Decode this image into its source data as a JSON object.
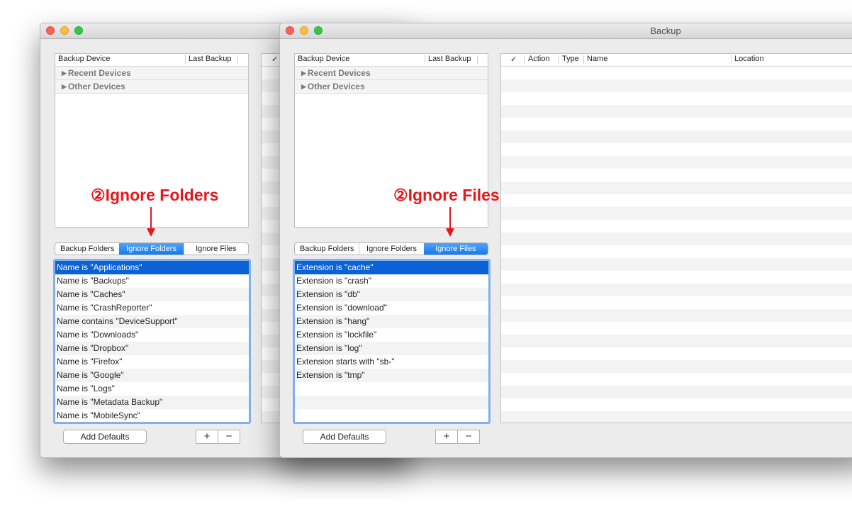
{
  "back_window": {
    "devices_table": {
      "columns": [
        "Backup Device",
        "Last Backup"
      ],
      "groups": [
        "Recent Devices",
        "Other Devices"
      ]
    },
    "right_table_check_header": "✓",
    "tabs": [
      {
        "label": "Backup Folders",
        "selected": false
      },
      {
        "label": "Ignore Folders",
        "selected": true
      },
      {
        "label": "Ignore Files",
        "selected": false
      }
    ],
    "rules": [
      "Name is \"Applications\"",
      "Name is \"Backups\"",
      "Name is \"Caches\"",
      "Name is \"CrashReporter\"",
      "Name contains \"DeviceSupport\"",
      "Name is \"Downloads\"",
      "Name is \"Dropbox\"",
      "Name is \"Firefox\"",
      "Name is \"Google\"",
      "Name is \"Logs\"",
      "Name is \"Metadata Backup\"",
      "Name is \"MobileSync\""
    ],
    "add_defaults_label": "Add Defaults",
    "plus_label": "+",
    "minus_label": "−",
    "annotation": "②Ignore Folders"
  },
  "front_window": {
    "title": "Backup",
    "devices_table": {
      "columns": [
        "Backup Device",
        "Last Backup"
      ],
      "groups": [
        "Recent Devices",
        "Other Devices"
      ]
    },
    "tabs": [
      {
        "label": "Backup Folders",
        "selected": false
      },
      {
        "label": "Ignore Folders",
        "selected": false
      },
      {
        "label": "Ignore Files",
        "selected": true
      }
    ],
    "rules": [
      "Extension is \"cache\"",
      "Extension is \"crash\"",
      "Extension is \"db\"",
      "Extension is \"download\"",
      "Extension is \"hang\"",
      "Extension is \"lockfile\"",
      "Extension is \"log\"",
      "Extension starts with \"sb-\"",
      "Extension is \"tmp\""
    ],
    "add_defaults_label": "Add Defaults",
    "plus_label": "+",
    "minus_label": "−",
    "annotation": "②Ignore Files",
    "files_table": {
      "columns": [
        "✓",
        "Action",
        "Type",
        "Name",
        "Location"
      ]
    }
  },
  "colors": {
    "annotation": "#e8161c",
    "selection": "#0b61d6",
    "segment_selected": "#1479f0",
    "focus_ring": "#7fb2ec"
  }
}
